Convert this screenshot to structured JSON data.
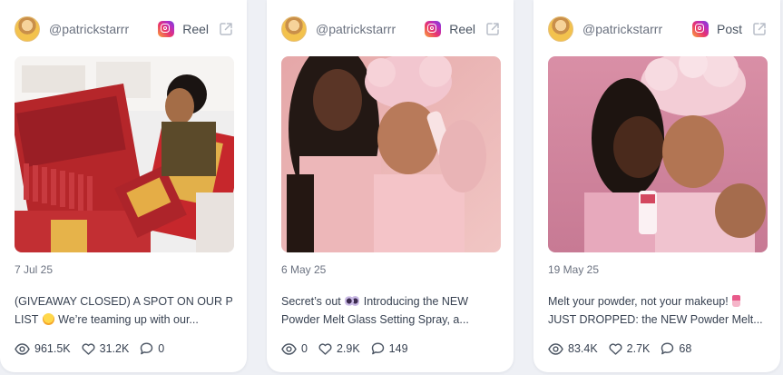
{
  "posts": [
    {
      "handle": "@patrickstarrr",
      "platform_icon": "instagram-icon",
      "type": "Reel",
      "date": "7 Jul 25",
      "caption_line1": "(GIVEAWAY CLOSED) A SPOT ON OUR PR",
      "caption_line2_before": "LIST ",
      "caption_line2_after": " We’re teaming up with our...",
      "views": "961.5K",
      "likes": "31.2K",
      "comments": "0"
    },
    {
      "handle": "@patrickstarrr",
      "platform_icon": "instagram-icon",
      "type": "Reel",
      "date": "6 May 25",
      "caption_line1_before": "Secret’s out ",
      "caption_line1_after": " Introducing the NEW",
      "caption_line2": "Powder Melt Glass Setting Spray, a...",
      "views": "0",
      "likes": "2.9K",
      "comments": "149"
    },
    {
      "handle": "@patrickstarrr",
      "platform_icon": "instagram-icon",
      "type": "Post",
      "date": "19 May 25",
      "caption_line1_before": "Melt your powder, not your makeup! ",
      "caption_line2": "JUST DROPPED: the NEW Powder Melt...",
      "views": "83.4K",
      "likes": "2.7K",
      "comments": "68"
    }
  ],
  "colors": {
    "instagram_gradient": [
      "#f9a43b",
      "#e8336f",
      "#b52fc4",
      "#6a43d8"
    ],
    "text_muted": "#6b7280",
    "text_body": "#374151"
  }
}
